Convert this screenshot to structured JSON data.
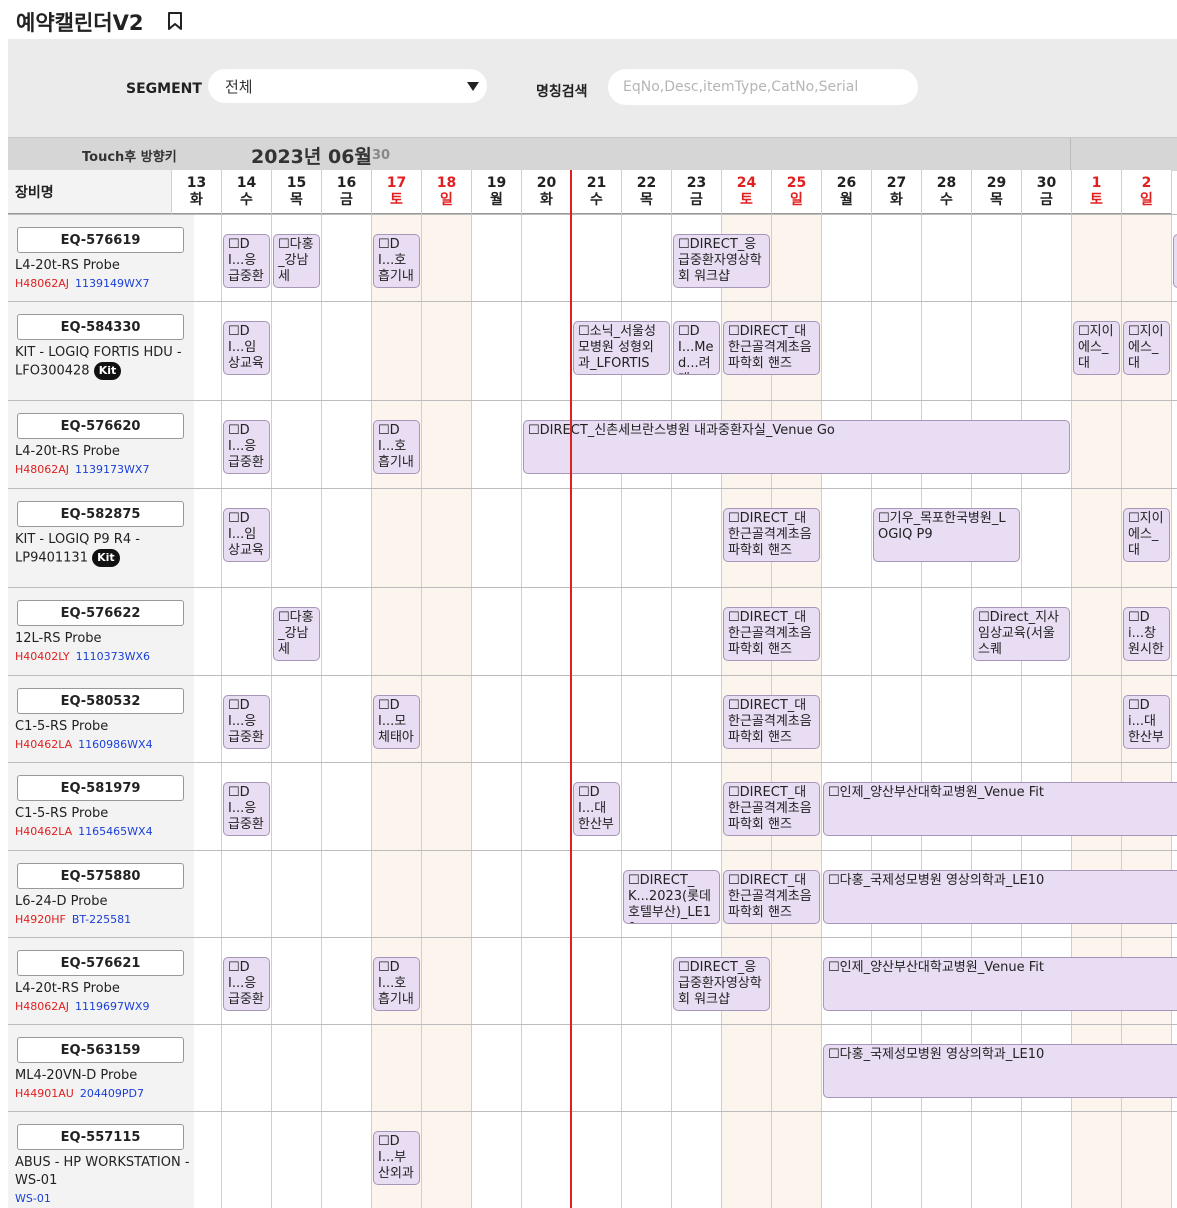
{
  "app": {
    "title": "예약캘린더V2",
    "bookmark_icon": "bookmark-icon"
  },
  "filters": {
    "segment_label": "SEGMENT",
    "segment_value": "전체",
    "name_search_label": "명칭검색",
    "name_search_placeholder": "EqNo,Desc,itemType,CatNo,Serial"
  },
  "month_bar": {
    "hint": "Touch후 방향키",
    "month": "2023년 06월",
    "days_in_month": "30"
  },
  "grid": {
    "equipment_header": "장비명",
    "days": [
      {
        "num": "13",
        "dow": "화",
        "weekend": false
      },
      {
        "num": "14",
        "dow": "수",
        "weekend": false
      },
      {
        "num": "15",
        "dow": "목",
        "weekend": false
      },
      {
        "num": "16",
        "dow": "금",
        "weekend": false
      },
      {
        "num": "17",
        "dow": "토",
        "weekend": true
      },
      {
        "num": "18",
        "dow": "일",
        "weekend": true
      },
      {
        "num": "19",
        "dow": "월",
        "weekend": false
      },
      {
        "num": "20",
        "dow": "화",
        "weekend": false
      },
      {
        "num": "21",
        "dow": "수",
        "weekend": false
      },
      {
        "num": "22",
        "dow": "목",
        "weekend": false
      },
      {
        "num": "23",
        "dow": "금",
        "weekend": false
      },
      {
        "num": "24",
        "dow": "토",
        "weekend": true
      },
      {
        "num": "25",
        "dow": "일",
        "weekend": true
      },
      {
        "num": "26",
        "dow": "월",
        "weekend": false
      },
      {
        "num": "27",
        "dow": "화",
        "weekend": false
      },
      {
        "num": "28",
        "dow": "수",
        "weekend": false
      },
      {
        "num": "29",
        "dow": "목",
        "weekend": false
      },
      {
        "num": "30",
        "dow": "금",
        "weekend": false
      },
      {
        "num": "1",
        "dow": "토",
        "weekend": true
      },
      {
        "num": "2",
        "dow": "일",
        "weekend": true
      }
    ],
    "colors": {
      "weekend_text": "#e02020",
      "weekend_bg": "#fbf5ee",
      "booking_bg": "#e8ddf2",
      "today_line": "#e02020"
    },
    "today_day": "20"
  },
  "equipment": [
    {
      "code": "EQ-576619",
      "desc": "L4-20t-RS Probe",
      "serial_red": "H48062AJ",
      "serial_blue": "1139149WX7",
      "kit": "",
      "bookings": [
        {
          "start": 1,
          "span": 1,
          "text": "☐DI...응급중환"
        },
        {
          "start": 2,
          "span": 1,
          "text": "☐다홍_강남세"
        },
        {
          "start": 4,
          "span": 1,
          "text": "☐DI...호흡기내"
        },
        {
          "start": 10,
          "span": 2,
          "text": "☐DIRECT_응급중환자영상학회 워크샵"
        },
        {
          "start": 20,
          "span": 1,
          "text": ""
        }
      ]
    },
    {
      "code": "EQ-584330",
      "desc": "KIT - LOGIQ FORTIS HDU - LFO300428",
      "serial_red": "",
      "serial_blue": "",
      "kit": "Kit",
      "bookings": [
        {
          "start": 1,
          "span": 1,
          "text": "☐DI...임상교육"
        },
        {
          "start": 8,
          "span": 2,
          "text": "☐소닉_서울성모병원 성형외과_LFORTIS"
        },
        {
          "start": 10,
          "span": 1,
          "text": "☐DI...Med...려대"
        },
        {
          "start": 11,
          "span": 2,
          "text": "☐DIRECT_대한근골격계초음파학회 핸즈"
        },
        {
          "start": 18,
          "span": 1,
          "text": "☐지이에스_대"
        },
        {
          "start": 19,
          "span": 1,
          "text": "☐지이에스_대"
        }
      ]
    },
    {
      "code": "EQ-576620",
      "desc": "L4-20t-RS Probe",
      "serial_red": "H48062AJ",
      "serial_blue": "1139173WX7",
      "kit": "",
      "bookings": [
        {
          "start": 1,
          "span": 1,
          "text": "☐DI...응급중환"
        },
        {
          "start": 4,
          "span": 1,
          "text": "☐DI...호흡기내"
        },
        {
          "start": 7,
          "span": 11,
          "text": "☐DIRECT_신촌세브란스병원 내과중환자실_Venue Go"
        }
      ]
    },
    {
      "code": "EQ-582875",
      "desc": "KIT - LOGIQ P9 R4 - LP9401131",
      "serial_red": "",
      "serial_blue": "",
      "kit": "Kit",
      "bookings": [
        {
          "start": 1,
          "span": 1,
          "text": "☐DI...임상교육"
        },
        {
          "start": 11,
          "span": 2,
          "text": "☐DIRECT_대한근골격계초음파학회 핸즈"
        },
        {
          "start": 14,
          "span": 3,
          "text": "☐기우_목포한국병원_LOGIQ P9"
        },
        {
          "start": 19,
          "span": 1,
          "text": "☐지이에스_대"
        }
      ]
    },
    {
      "code": "EQ-576622",
      "desc": "12L-RS Probe",
      "serial_red": "H40402LY",
      "serial_blue": "1110373WX6",
      "kit": "",
      "bookings": [
        {
          "start": 2,
          "span": 1,
          "text": "☐다홍_강남세"
        },
        {
          "start": 11,
          "span": 2,
          "text": "☐DIRECT_대한근골격계초음파학회 핸즈"
        },
        {
          "start": 16,
          "span": 2,
          "text": "☐Direct_지사임상교육(서울스퀘"
        },
        {
          "start": 19,
          "span": 1,
          "text": "☐Di...창원시한"
        }
      ]
    },
    {
      "code": "EQ-580532",
      "desc": "C1-5-RS Probe",
      "serial_red": "H40462LA",
      "serial_blue": "1160986WX4",
      "kit": "",
      "bookings": [
        {
          "start": 1,
          "span": 1,
          "text": "☐DI...응급중환"
        },
        {
          "start": 4,
          "span": 1,
          "text": "☐DI...모체태아"
        },
        {
          "start": 11,
          "span": 2,
          "text": "☐DIRECT_대한근골격계초음파학회 핸즈"
        },
        {
          "start": 19,
          "span": 1,
          "text": "☐Di...대한산부"
        }
      ]
    },
    {
      "code": "EQ-581979",
      "desc": "C1-5-RS Probe",
      "serial_red": "H40462LA",
      "serial_blue": "1165465WX4",
      "kit": "",
      "bookings": [
        {
          "start": 1,
          "span": 1,
          "text": "☐DI...응급중환"
        },
        {
          "start": 8,
          "span": 1,
          "text": "☐DI...대한산부"
        },
        {
          "start": 11,
          "span": 2,
          "text": "☐DIRECT_대한근골격계초음파학회 핸즈"
        },
        {
          "start": 13,
          "span": 8,
          "text": "☐인제_양산부산대학교병원_Venue Fit"
        }
      ]
    },
    {
      "code": "EQ-575880",
      "desc": "L6-24-D Probe",
      "serial_red": "H4920HF",
      "serial_blue": "BT-225581",
      "kit": "",
      "bookings": [
        {
          "start": 9,
          "span": 2,
          "text": "☐DIRECT_K...2023(롯데호텔부산)_LE10"
        },
        {
          "start": 11,
          "span": 2,
          "text": "☐DIRECT_대한근골격계초음파학회 핸즈"
        },
        {
          "start": 13,
          "span": 8,
          "text": "☐다홍_국제성모병원 영상의학과_LE10"
        }
      ]
    },
    {
      "code": "EQ-576621",
      "desc": "L4-20t-RS Probe",
      "serial_red": "H48062AJ",
      "serial_blue": "1119697WX9",
      "kit": "",
      "bookings": [
        {
          "start": 1,
          "span": 1,
          "text": "☐DI...응급중환"
        },
        {
          "start": 4,
          "span": 1,
          "text": "☐DI...호흡기내"
        },
        {
          "start": 10,
          "span": 2,
          "text": "☐DIRECT_응급중환자영상학회 워크샵"
        },
        {
          "start": 13,
          "span": 8,
          "text": "☐인제_양산부산대학교병원_Venue Fit"
        }
      ]
    },
    {
      "code": "EQ-563159",
      "desc": "ML4-20VN-D Probe",
      "serial_red": "H44901AU",
      "serial_blue": "204409PD7",
      "kit": "",
      "bookings": [
        {
          "start": 13,
          "span": 8,
          "text": "☐다홍_국제성모병원 영상의학과_LE10"
        }
      ]
    },
    {
      "code": "EQ-557115",
      "desc": "ABUS - HP WORKSTATION - WS-01",
      "serial_red": "",
      "serial_blue": "WS-01",
      "kit": "",
      "bookings": [
        {
          "start": 4,
          "span": 1,
          "text": "☐DI...부산외과"
        }
      ]
    }
  ]
}
